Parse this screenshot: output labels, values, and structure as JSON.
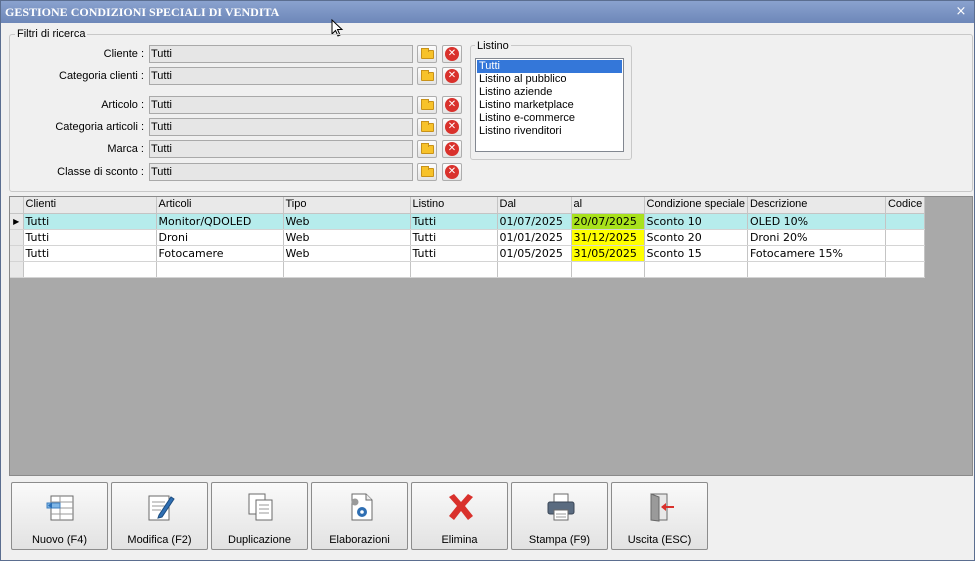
{
  "window": {
    "title": "GESTIONE CONDIZIONI SPECIALI DI VENDITA",
    "close_glyph": "×"
  },
  "filters": {
    "legend": "Filtri di ricerca",
    "rows": [
      {
        "label": "Cliente :",
        "value": "Tutti"
      },
      {
        "label": "Categoria clienti :",
        "value": "Tutti"
      },
      {
        "label": "Articolo :",
        "value": "Tutti"
      },
      {
        "label": "Categoria articoli :",
        "value": "Tutti"
      },
      {
        "label": "Marca :",
        "value": "Tutti"
      },
      {
        "label": "Classe di sconto :",
        "value": "Tutti"
      }
    ],
    "clear_glyph": "✕"
  },
  "listino": {
    "legend": "Listino",
    "items": [
      "Tutti",
      "Listino al pubblico",
      "Listino aziende",
      "Listino marketplace",
      "Listino e-commerce",
      "Listino rivenditori"
    ],
    "selected": "Tutti"
  },
  "grid": {
    "columns": [
      "Clienti",
      "Articoli",
      "Tipo",
      "Listino",
      "Dal",
      "al",
      "Condizione speciale",
      "Descrizione",
      "Codice"
    ],
    "current_row_marker": "▶",
    "rows": [
      [
        "Tutti",
        "Monitor/QDOLED",
        "Web",
        "Tutti",
        "01/07/2025",
        "20/07/2025",
        "Sconto 10",
        "OLED 10%",
        ""
      ],
      [
        "Tutti",
        "Droni",
        "Web",
        "Tutti",
        "01/01/2025",
        "31/12/2025",
        "Sconto 20",
        "Droni 20%",
        ""
      ],
      [
        "Tutti",
        "Fotocamere",
        "Web",
        "Tutti",
        "01/05/2025",
        "31/05/2025",
        "Sconto 15",
        "Fotocamere 15%",
        ""
      ]
    ]
  },
  "toolbar": {
    "buttons": [
      {
        "label": "Nuovo (F4)",
        "icon": "new-icon"
      },
      {
        "label": "Modifica (F2)",
        "icon": "edit-icon"
      },
      {
        "label": "Duplicazione",
        "icon": "duplicate-icon"
      },
      {
        "label": "Elaborazioni",
        "icon": "process-icon"
      },
      {
        "label": "Elimina",
        "icon": "delete-icon"
      },
      {
        "label": "Stampa (F9)",
        "icon": "print-icon"
      },
      {
        "label": "Uscita (ESC)",
        "icon": "exit-icon"
      }
    ]
  },
  "colors": {
    "titlebar": "#7a93c4",
    "current_row": "#b6ecec",
    "date_highlight_green": "#a8e21c",
    "date_highlight_yellow": "#ffff00",
    "listino_selected": "#3477d9",
    "delete_red": "#d9312c"
  }
}
